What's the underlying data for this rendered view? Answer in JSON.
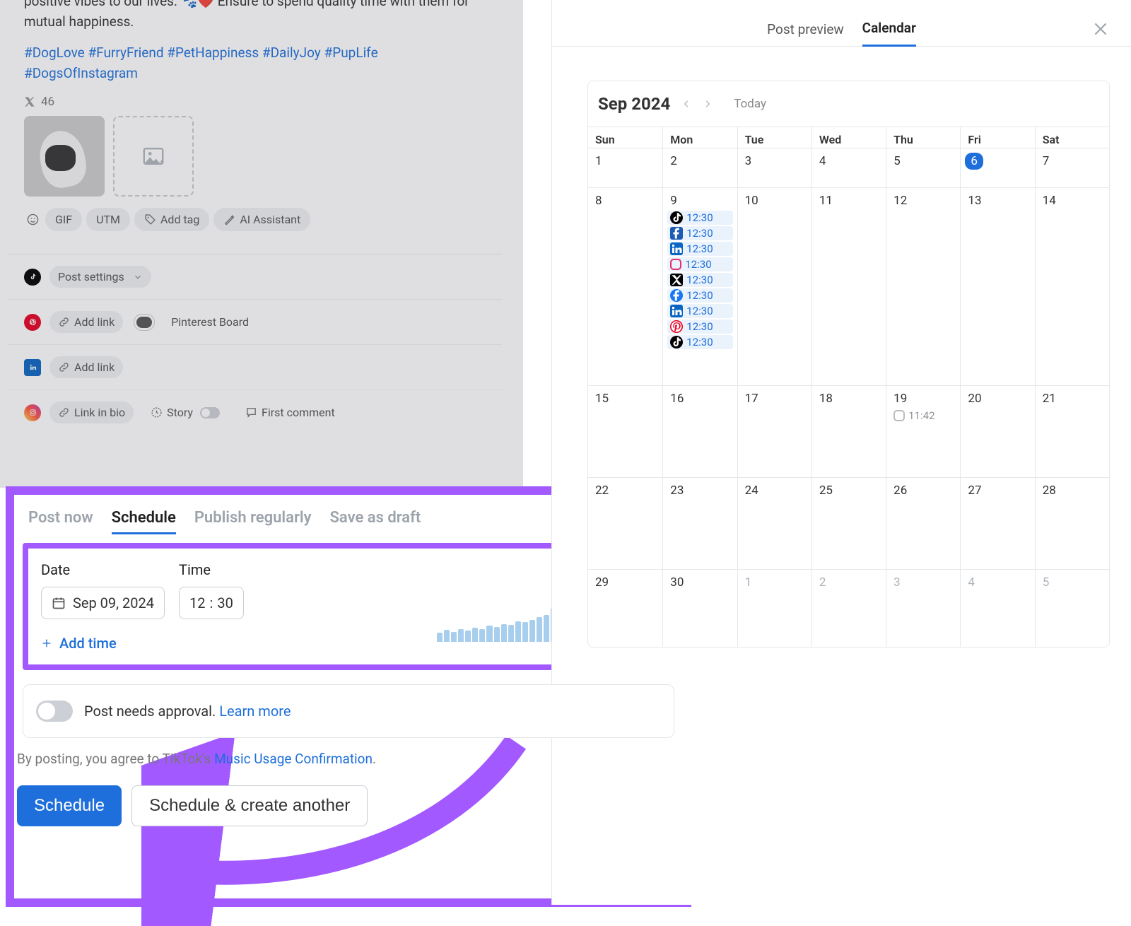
{
  "left": {
    "text": "positive vibes to our lives. 🐾❤️ Ensure to spend quality time with them for mutual happiness.",
    "hashtags": "#DogLove #FurryFriend #PetHappiness #DailyJoy #PupLife #DogsOfInstagram",
    "x_count": "46",
    "toolbar": {
      "gif": "GIF",
      "utm": "UTM",
      "add_tag": "Add tag",
      "ai": "AI Assistant"
    },
    "networks": {
      "tiktok": {
        "post_settings": "Post settings"
      },
      "pinterest": {
        "add_link": "Add link",
        "board": "Pinterest Board"
      },
      "linkedin": {
        "add_link": "Add link"
      },
      "instagram": {
        "link_in_bio": "Link in bio",
        "story": "Story",
        "first_comment": "First comment"
      }
    }
  },
  "schedule": {
    "tabs": {
      "post_now": "Post now",
      "schedule": "Schedule",
      "publish_regularly": "Publish regularly",
      "save_draft": "Save as draft"
    },
    "date_label": "Date",
    "time_label": "Time",
    "date_value": "Sep 09, 2024",
    "time_h": "12",
    "time_sep": ":",
    "time_m": "30",
    "add_time": "Add time",
    "approval_text": "Post needs approval.",
    "learn_more": "Learn more",
    "agree_prefix": "By posting, you agree to TikTok's",
    "agree_link": "Music Usage Confirmation",
    "agree_suffix": ".",
    "btn_schedule": "Schedule",
    "btn_another": "Schedule & create another"
  },
  "calendar": {
    "tabs": {
      "preview": "Post preview",
      "calendar": "Calendar"
    },
    "title": "Sep 2024",
    "today": "Today",
    "dow": [
      "Sun",
      "Mon",
      "Tue",
      "Wed",
      "Thu",
      "Fri",
      "Sat"
    ],
    "weeks": [
      [
        {
          "n": "1"
        },
        {
          "n": "2"
        },
        {
          "n": "3"
        },
        {
          "n": "4"
        },
        {
          "n": "5"
        },
        {
          "n": "6",
          "today": true
        },
        {
          "n": "7"
        }
      ],
      [
        {
          "n": "8"
        },
        {
          "n": "9",
          "events": [
            {
              "icon": "tt",
              "t": "12:30"
            },
            {
              "icon": "fb-alt",
              "t": "12:30"
            },
            {
              "icon": "li",
              "t": "12:30"
            },
            {
              "icon": "ig-o",
              "t": "12:30"
            },
            {
              "icon": "x",
              "t": "12:30"
            },
            {
              "icon": "fb",
              "t": "12:30"
            },
            {
              "icon": "li",
              "t": "12:30"
            },
            {
              "icon": "pin",
              "t": "12:30"
            },
            {
              "icon": "tt",
              "t": "12:30"
            }
          ]
        },
        {
          "n": "10"
        },
        {
          "n": "11"
        },
        {
          "n": "12"
        },
        {
          "n": "13"
        },
        {
          "n": "14"
        }
      ],
      [
        {
          "n": "15"
        },
        {
          "n": "16"
        },
        {
          "n": "17"
        },
        {
          "n": "18"
        },
        {
          "n": "19",
          "events": [
            {
              "icon": "ig-g",
              "t": "11:42",
              "nobg": true
            }
          ]
        },
        {
          "n": "20"
        },
        {
          "n": "21"
        }
      ],
      [
        {
          "n": "22"
        },
        {
          "n": "23"
        },
        {
          "n": "24"
        },
        {
          "n": "25"
        },
        {
          "n": "26"
        },
        {
          "n": "27"
        },
        {
          "n": "28"
        }
      ],
      [
        {
          "n": "29"
        },
        {
          "n": "30"
        },
        {
          "n": "1",
          "grey": true
        },
        {
          "n": "2",
          "grey": true
        },
        {
          "n": "3",
          "grey": true
        },
        {
          "n": "4",
          "grey": true
        },
        {
          "n": "5",
          "grey": true
        }
      ]
    ]
  }
}
